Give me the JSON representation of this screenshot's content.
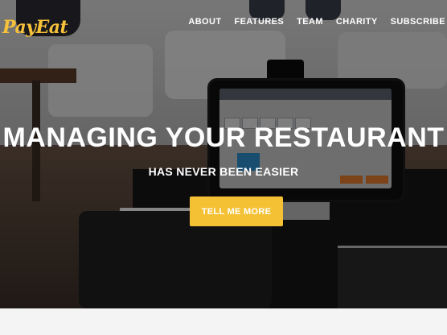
{
  "brand": {
    "logo_text": "PayEat",
    "accent": "#f4c135"
  },
  "nav": {
    "items": [
      {
        "label": "ABOUT"
      },
      {
        "label": "FEATURES"
      },
      {
        "label": "TEAM"
      },
      {
        "label": "CHARITY"
      },
      {
        "label": "SUBSCRIBE"
      }
    ]
  },
  "hero": {
    "headline": "MANAGING YOUR RESTAURANT",
    "subheadline": "HAS NEVER BEEN EASIER",
    "cta_label": "TELL ME MORE",
    "background_image": "restaurant-pos-terminal-photo"
  }
}
